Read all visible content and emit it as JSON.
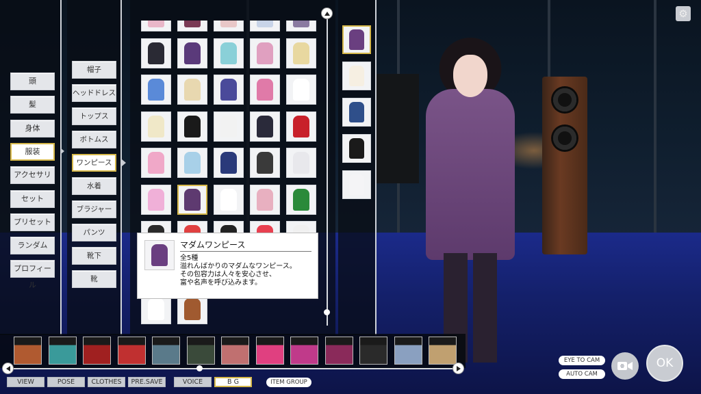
{
  "categories": [
    {
      "label": "頭",
      "selected": false
    },
    {
      "label": "髪",
      "selected": false
    },
    {
      "label": "身体",
      "selected": false
    },
    {
      "label": "服装",
      "selected": true
    },
    {
      "label": "アクセサリ",
      "selected": false
    },
    {
      "label": "セット",
      "selected": false
    },
    {
      "label": "プリセット",
      "selected": false
    },
    {
      "label": "ランダム",
      "selected": false
    },
    {
      "label": "プロフィール",
      "selected": false
    }
  ],
  "subcategories": [
    {
      "label": "帽子",
      "selected": false
    },
    {
      "label": "ヘッドドレス",
      "selected": false
    },
    {
      "label": "トップス",
      "selected": false
    },
    {
      "label": "ボトムス",
      "selected": false
    },
    {
      "label": "ワンピース",
      "selected": true
    },
    {
      "label": "水着",
      "selected": false
    },
    {
      "label": "ブラジャー",
      "selected": false
    },
    {
      "label": "パンツ",
      "selected": false
    },
    {
      "label": "靴下",
      "selected": false
    },
    {
      "label": "靴",
      "selected": false
    }
  ],
  "items": [
    [
      "#e9b7c8",
      "#7a3a55",
      "#e8c7c7",
      "#c8d4e8",
      "#8a7aa0"
    ],
    [
      "#2a2a34",
      "#5a3a7a",
      "#8ad0d8",
      "#e0a0c0",
      "#e8d8a0"
    ],
    [
      "#5a8ad8",
      "#e8d8b0",
      "#4a4a9a",
      "#e07aa8",
      "#ffffff"
    ],
    [
      "#f0e8c8",
      "#1a1a1a",
      "#f2f2f2",
      "#2a2a3a",
      "#c8202a"
    ],
    [
      "#f0a8c8",
      "#a8d0e8",
      "#2a3a7a",
      "#3a3a3a",
      "#e8e8ec"
    ],
    [
      "#f0b0d8",
      "#5e3a70",
      "#ffffff",
      "#e8b0c0",
      "#2a8a3a"
    ],
    [
      "#2a2a2a",
      "#e04040",
      "#222222",
      "#e84050",
      "#f0f0f0"
    ],
    [
      "#ffffff",
      "#c0903a",
      "",
      "",
      ""
    ],
    [
      "#ffffff",
      "#a05a30",
      "",
      "",
      ""
    ]
  ],
  "selected_item": {
    "row": 5,
    "col": 1
  },
  "variants": [
    "#6a3f80",
    "#f6efe2",
    "#2f4f8a",
    "#1a1a1a",
    "#f4f4f6"
  ],
  "selected_variant": 0,
  "tooltip": {
    "title": "マダムワンピース",
    "line1": "全5種",
    "line2": "溢れんばかりのマダムなワンピース。",
    "line3": "その包容力は人々を安心させ、",
    "line4": "富や名声を呼び込みます。"
  },
  "bg_thumbs": [
    "#b05a30",
    "#3a9a9a",
    "#a02020",
    "#c03030",
    "#5a7a8a",
    "#3a4a3a",
    "#c07070",
    "#e04080",
    "#c03a8a",
    "#8a2a5a",
    "#2a2a2a",
    "#8aa0c0",
    "#c0a070"
  ],
  "menu": [
    {
      "label": "VIEW",
      "active": false
    },
    {
      "label": "POSE",
      "active": false
    },
    {
      "label": "CLOTHES",
      "active": false
    },
    {
      "label": "PRE.SAVE",
      "active": false
    },
    {
      "label": "VOICE",
      "active": false
    },
    {
      "label": "B G",
      "active": true
    }
  ],
  "item_group_label": "ITEM GROUP",
  "eye_to_cam_label": "EYE TO CAM",
  "auto_cam_label": "AUTO CAM",
  "ok_label": "OK",
  "icons": {
    "gear": "gear-icon",
    "camera": "video-camera-icon"
  }
}
